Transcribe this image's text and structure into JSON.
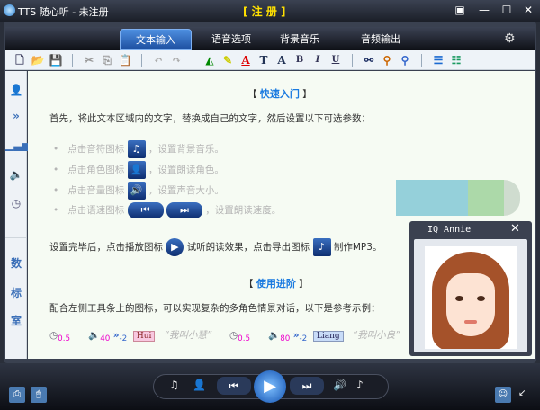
{
  "window": {
    "title": "TTS 随心听  -  未注册",
    "register": "[ 注 册 ]"
  },
  "tabs": [
    {
      "label": "文本输入",
      "active": true
    },
    {
      "label": "语音选项"
    },
    {
      "label": "背景音乐"
    },
    {
      "label": "音频输出"
    }
  ],
  "sidebar": {
    "labels": [
      "数",
      "标",
      "室"
    ]
  },
  "content": {
    "quick_title": "快速入门",
    "intro": "首先，将此文本区域内的文字，替换成自己的文字，然后设置以下可选参数：",
    "items": [
      {
        "pre": "点击音符图标",
        "post": "，设置背景音乐。",
        "icon": "music-note-icon"
      },
      {
        "pre": "点击角色图标",
        "post": "，设置朗读角色。",
        "icon": "person-icon"
      },
      {
        "pre": "点击音量图标",
        "post": "，设置声音大小。",
        "icon": "volume-icon"
      },
      {
        "pre": "点击语速图标",
        "post": "，设置朗读速度。",
        "icon": "rewind-forward-icon"
      }
    ],
    "after_pre": "设置完毕后，点击播放图标",
    "after_mid": "试听朗读效果，点击导出图标",
    "after_post": "制作MP3。",
    "adv_title": "使用进阶",
    "adv_text": "配合左侧工具条上的图标，可以实现复杂的多角色情景对话，以下是参考示例：",
    "examples": [
      {
        "speed": "0.5",
        "vol": "40",
        "rate": "-2",
        "role": "Hui",
        "quote": "“我叫小慧”",
        "role_color": "#f8c8e0"
      },
      {
        "speed": "0.5",
        "vol": "80",
        "rate": "-2",
        "role": "Liang",
        "quote": "“我叫小良”",
        "role_color": "#c8dcf8"
      }
    ]
  },
  "char_panel": {
    "name": "IQ Annie"
  },
  "colors": {
    "accent": "#1a7ae0",
    "register": "#ffe000",
    "content_bg": "#f6fbf3"
  }
}
